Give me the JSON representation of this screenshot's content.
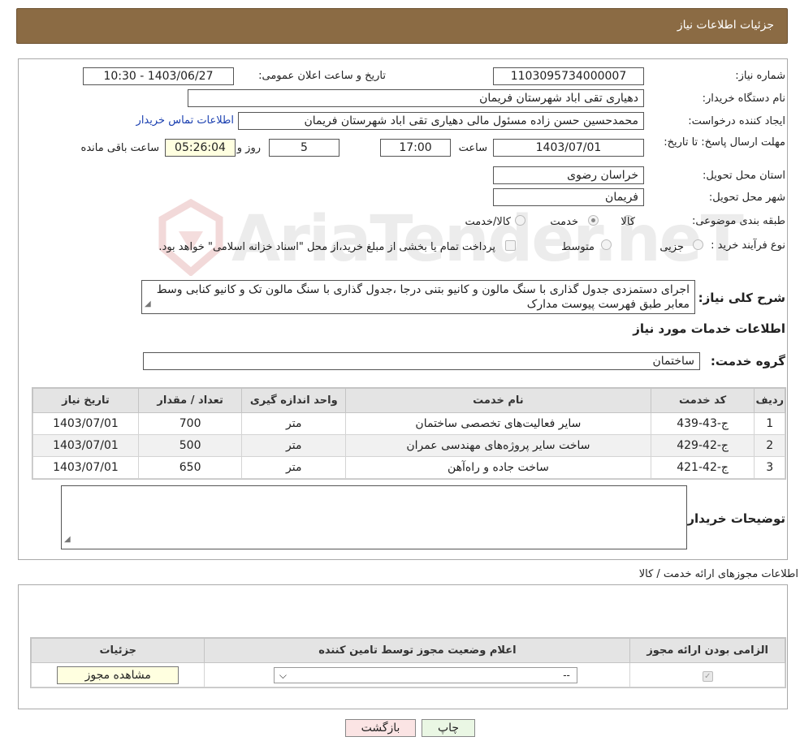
{
  "header": {
    "title": "جزئیات اطلاعات نیاز"
  },
  "form": {
    "need_number_label": "شماره نیاز:",
    "need_number": "1103095734000007",
    "announce_label": "تاریخ و ساعت اعلان عمومی:",
    "announce_value": "1403/06/27 - 10:30",
    "buyer_org_label": "نام دستگاه خریدار:",
    "buyer_org": "دهیاری تقی اباد شهرستان فریمان",
    "creator_label": "ایجاد کننده درخواست:",
    "creator": "محمدحسین حسن زاده مسئول مالی دهیاری تقی اباد شهرستان فریمان",
    "contact_link": "اطلاعات تماس خریدار",
    "deadline_label": "مهلت ارسال پاسخ: تا تاریخ:",
    "deadline_date": "1403/07/01",
    "time_label": "ساعت",
    "deadline_time": "17:00",
    "days_value": "5",
    "days_label": "روز و",
    "remaining_time": "05:26:04",
    "remaining_label": "ساعت باقی مانده",
    "province_label": "استان محل تحویل:",
    "province": "خراسان رضوی",
    "city_label": "شهر محل تحویل:",
    "city": "فریمان",
    "category_label": "طبقه بندی موضوعی:",
    "category_options": [
      "کالا",
      "خدمت",
      "کالا/خدمت"
    ],
    "category_selected": "خدمت",
    "process_label": "نوع فرآیند خرید :",
    "process_options": [
      "جزیی",
      "متوسط"
    ],
    "payment_note": "پرداخت تمام یا بخشی از مبلغ خرید،از محل \"اسناد خزانه اسلامی\" خواهد بود.",
    "description_label": "شرح کلی نیاز:",
    "description": "اجرای دستمزدی جدول گذاری با سنگ مالون و  کانیو بتنی درجا ،جدول گذاری با سنگ مالون تک و کانیو کنابی وسط معابر طبق فهرست پیوست مدارک",
    "services_heading": "اطلاعات خدمات مورد نیاز",
    "service_group_label": "گروه خدمت:",
    "service_group": "ساختمان",
    "buyer_notes_label": "توضیحات خریدار:"
  },
  "services_table": {
    "headers": [
      "ردیف",
      "کد خدمت",
      "نام خدمت",
      "واحد اندازه گیری",
      "تعداد / مقدار",
      "تاریخ نیاز"
    ],
    "rows": [
      [
        "1",
        "ج-43-439",
        "سایر فعالیت‌های تخصصی ساختمان",
        "متر",
        "700",
        "1403/07/01"
      ],
      [
        "2",
        "ج-42-429",
        "ساخت سایر پروژه‌های مهندسی عمران",
        "متر",
        "500",
        "1403/07/01"
      ],
      [
        "3",
        "ج-42-421",
        "ساخت جاده و راه‌آهن",
        "متر",
        "650",
        "1403/07/01"
      ]
    ]
  },
  "permits": {
    "heading": "اطلاعات مجوزهای ارائه خدمت / کالا",
    "headers": [
      "الزامی بودن ارائه مجوز",
      "اعلام وضعیت مجوز توسط تامین کننده",
      "جزئیات"
    ],
    "select_value": "--",
    "view_button": "مشاهده مجوز"
  },
  "buttons": {
    "print": "چاپ",
    "back": "بازگشت"
  },
  "watermark": {
    "text": "AriaTender.neT"
  },
  "colors": {
    "header_bg": "#8b6b44",
    "print_btn": "#eaf7e4",
    "back_btn": "#fbe4e4"
  }
}
